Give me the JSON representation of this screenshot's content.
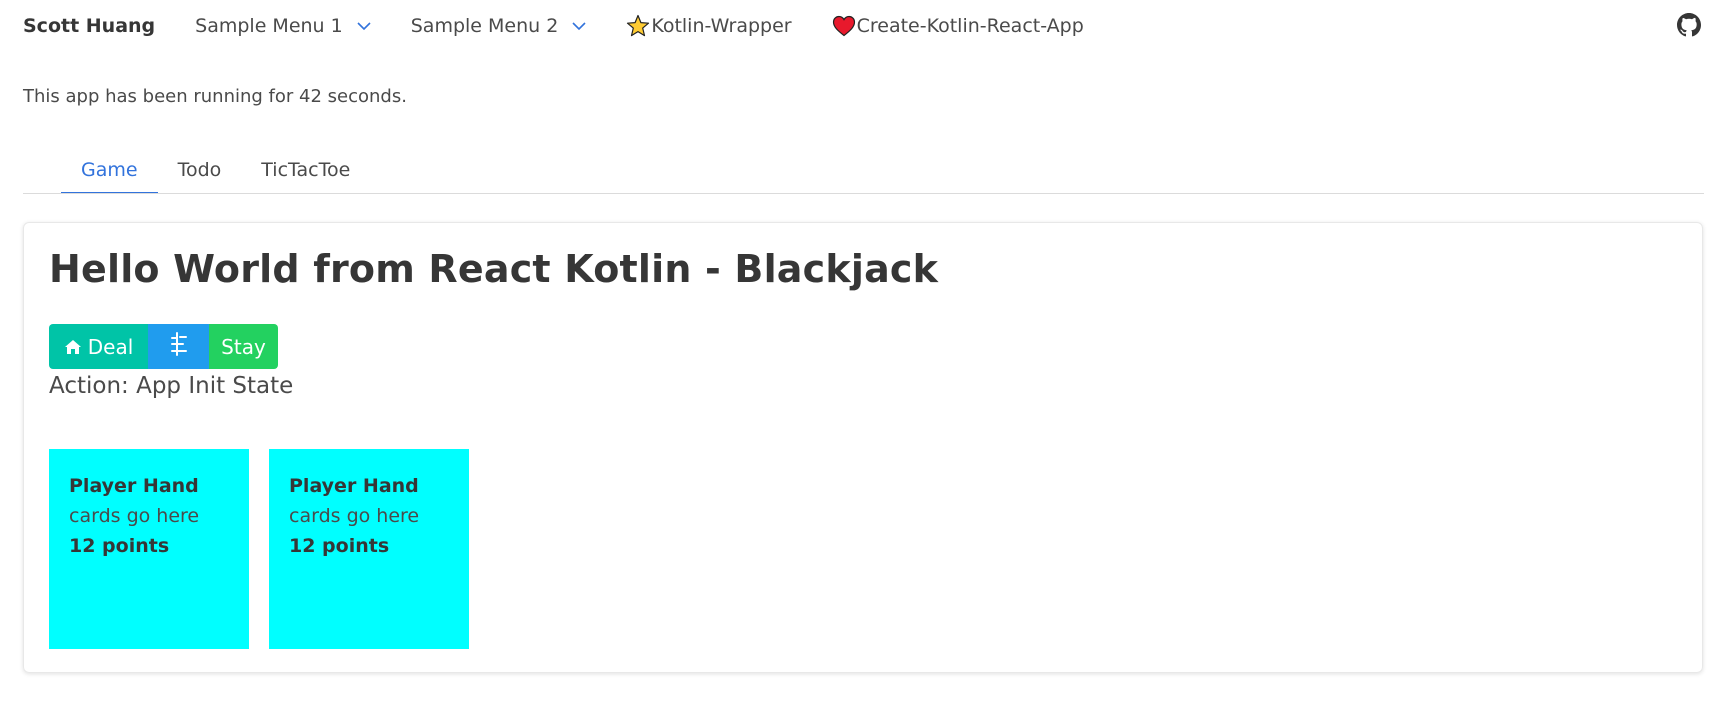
{
  "navbar": {
    "brand": "Scott Huang",
    "menu1": "Sample Menu 1",
    "menu2": "Sample Menu 2",
    "link1": "Kotlin-Wrapper",
    "link2": "Create-Kotlin-React-App"
  },
  "status_text": "This app has been running for 42 seconds.",
  "tabs": [
    {
      "label": "Game",
      "active": true
    },
    {
      "label": "Todo",
      "active": false
    },
    {
      "label": "TicTacToe",
      "active": false
    }
  ],
  "game": {
    "title": "Hello World from React Kotlin - Blackjack",
    "deal_label": "Deal",
    "hit_icon": "hit-icon",
    "stay_label": "Stay",
    "action_text": "Action: App Init State",
    "hands": [
      {
        "title": "Player Hand",
        "cards": "cards go here",
        "points": "12 points"
      },
      {
        "title": "Player Hand",
        "cards": "cards go here",
        "points": "12 points"
      }
    ]
  },
  "colors": {
    "accent": "#3273dc",
    "deal": "#00c4a7",
    "hit": "#209cee",
    "stay": "#23d160",
    "hand_bg": "#00ffff"
  },
  "icons": {
    "menu_chevron": "chevron-down-icon",
    "star": "star-icon",
    "heart": "heart-icon",
    "github": "github-icon",
    "home": "home-icon"
  }
}
